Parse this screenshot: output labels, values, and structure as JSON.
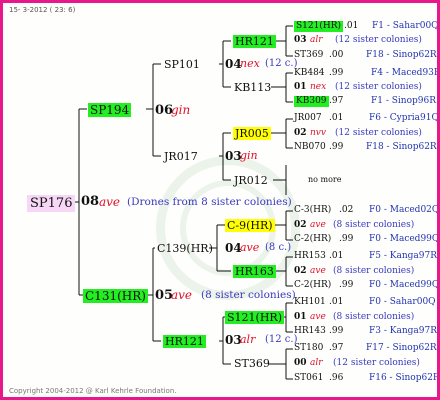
{
  "header": "15-  3-2012 ( 23:  6)",
  "footer": "Copyright 2004-2012 @ Karl Kehrle Foundation.",
  "root": {
    "name": "SP176",
    "num": "08",
    "race": "ave",
    "note": "(Drones from 8 sister colonies)"
  },
  "p1": {
    "name": "SP194",
    "num": "06",
    "race": "gin"
  },
  "p1a": {
    "name": "SP101",
    "num": "04",
    "race": "nex",
    "note": "(12 c.)"
  },
  "p1a1": {
    "name": "HR121"
  },
  "p1a2": {
    "name": "KB113"
  },
  "p1b": {
    "name": "JR017",
    "num": "03",
    "race": "gin"
  },
  "p1b1": {
    "name": "JR005"
  },
  "p1b2": {
    "name": "JR012"
  },
  "p2": {
    "name": "C131(HR)",
    "num": "05",
    "race": "ave",
    "note": "(8 sister colonies)"
  },
  "p2a": {
    "name": "C139(HR)",
    "num": "04",
    "race": "ave",
    "note": "(8 c.)"
  },
  "p2a1": {
    "name": "C-9(HR)"
  },
  "p2a2": {
    "name": "HR163"
  },
  "p2b": {
    "name": "HR121",
    "num": "03",
    "race": "alr",
    "note": "(12 c.)"
  },
  "p2b1": {
    "name": "S121(HR)"
  },
  "p2b2": {
    "name": "ST369"
  },
  "no_more": "no more",
  "rows": [
    {
      "name": "S121(HR)",
      "yr": ".01",
      "right": "F1 - Sahar00Q"
    },
    {
      "num": "03",
      "race": "alr",
      "note": "(12 sister colonies)"
    },
    {
      "name": "ST369",
      "yr": ".00",
      "right": "F18 - Sinop62R"
    },
    {
      "name": "KB484",
      "yr": ".99",
      "right": "F4 - Maced93R"
    },
    {
      "num": "01",
      "race": "nex",
      "note": "(12 sister colonies)"
    },
    {
      "name": "KB309",
      "yr": ".97",
      "right": "F1 - Sinop96R"
    },
    {
      "name": "JR007",
      "yr": ".01",
      "right": "F6 - Cypria91Q"
    },
    {
      "num": "02",
      "race": "nvv",
      "note": "(12 sister colonies)"
    },
    {
      "name": "NB070",
      "yr": ".99",
      "right": "F18 - Sinop62R"
    },
    {
      "name": "C-3(HR)",
      "yr": ".02",
      "right": "F0 - Maced02Q"
    },
    {
      "num": "02",
      "race": "ave",
      "note": "(8 sister colonies)"
    },
    {
      "name": "C-2(HR)",
      "yr": ".99",
      "right": "F0 - Maced99Q"
    },
    {
      "name": "HR153",
      "yr": ".01",
      "right": "F5 - Kanga97R"
    },
    {
      "num": "02",
      "race": "ave",
      "note": "(8 sister colonies)"
    },
    {
      "name": "C-2(HR)",
      "yr": ".99",
      "right": "F0 - Maced99Q"
    },
    {
      "name": "KH101",
      "yr": ".01",
      "right": "F0 - Sahar00Q"
    },
    {
      "num": "01",
      "race": "ave",
      "note": "(8 sister colonies)"
    },
    {
      "name": "HR143",
      "yr": ".99",
      "right": "F3 - Kanga97R"
    },
    {
      "name": "ST180",
      "yr": ".97",
      "right": "F17 - Sinop62R"
    },
    {
      "num": "00",
      "race": "alr",
      "note": "(12 sister colonies)"
    },
    {
      "name": "ST061",
      "yr": ".96",
      "right": "F16 - Sinop62R"
    }
  ]
}
